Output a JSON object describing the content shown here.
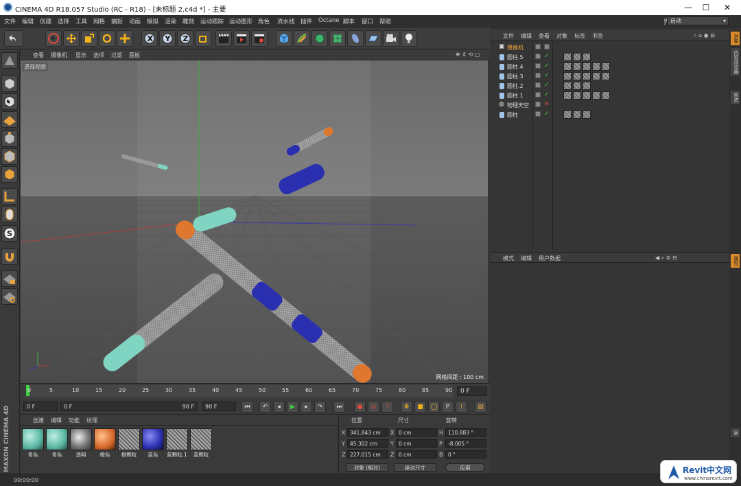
{
  "window": {
    "title": "CINEMA 4D R18.057 Studio (RC - R18) - [未标题 2.c4d *] - 主要",
    "min": "—",
    "max": "☐",
    "close": "✕"
  },
  "menu": [
    "文件",
    "编辑",
    "创建",
    "选择",
    "工具",
    "网格",
    "捕捉",
    "动画",
    "模拟",
    "渲染",
    "雕刻",
    "运动跟踪",
    "运动图形",
    "角色",
    "流水线",
    "插件",
    "Octane",
    "脚本",
    "窗口",
    "帮助"
  ],
  "layout": {
    "label": "界面:",
    "value": "启动"
  },
  "viewport": {
    "menu": [
      "查看",
      "摄像机",
      "显示",
      "选项",
      "过滤",
      "面板"
    ],
    "label": "透视视图",
    "grid_info": "网格间距 : 100 cm"
  },
  "timeline": {
    "ticks": [
      "0",
      "5",
      "10",
      "15",
      "20",
      "25",
      "30",
      "35",
      "40",
      "45",
      "50",
      "55",
      "60",
      "65",
      "70",
      "75",
      "80",
      "85",
      "90"
    ],
    "frame": "0 F"
  },
  "transport": {
    "start": "0 F",
    "current": "0 F",
    "end_slider": "90 F",
    "end": "90 F"
  },
  "materials": {
    "menu": [
      "创建",
      "编辑",
      "功能",
      "纹理"
    ],
    "items": [
      "青色",
      "青色",
      "透明",
      "橙色",
      "橙颗粒",
      "蓝色",
      "蓝颗粒.1",
      "蓝颗粒"
    ]
  },
  "coords": {
    "headers": [
      "位置",
      "尺寸",
      "旋转"
    ],
    "rows": [
      {
        "a": "X",
        "pos": "341.843 cm",
        "b": "X",
        "size": "0 cm",
        "c": "H",
        "rot": "110.883 °"
      },
      {
        "a": "Y",
        "pos": "45.302 cm",
        "b": "Y",
        "size": "0 cm",
        "c": "P",
        "rot": "-8.005 °"
      },
      {
        "a": "Z",
        "pos": "227.015 cm",
        "b": "Z",
        "size": "0 cm",
        "c": "B",
        "rot": "0 °"
      }
    ],
    "mode": "对象 (相对)",
    "size_mode": "绝对尺寸",
    "apply": "应用"
  },
  "objects": {
    "menu": [
      "文件",
      "编辑",
      "查看",
      "对象",
      "标签",
      "书签"
    ],
    "items": [
      {
        "name": "摄像机",
        "color": "#e8a33c",
        "tags": 0
      },
      {
        "name": "圆柱.5",
        "color": "#dddddd",
        "tags": 3
      },
      {
        "name": "圆柱.4",
        "color": "#dddddd",
        "tags": 5
      },
      {
        "name": "圆柱.3",
        "color": "#dddddd",
        "tags": 5
      },
      {
        "name": "圆柱.2",
        "color": "#dddddd",
        "tags": 3
      },
      {
        "name": "圆柱.1",
        "color": "#dddddd",
        "tags": 5
      },
      {
        "name": "物理天空",
        "color": "#dddddd",
        "tags": 0
      },
      {
        "name": "圆柱",
        "color": "#dddddd",
        "tags": 3
      }
    ]
  },
  "attributes": {
    "menu": [
      "模式",
      "编辑",
      "用户数据"
    ]
  },
  "right_tabs": [
    "对象",
    "内容浏览器",
    "构造",
    "属性",
    "层"
  ],
  "status": "00:00:00",
  "brand": "MAXON CINEMA 4D",
  "watermark": {
    "title": "Revit中文网",
    "url": "www.chinarevit.com"
  },
  "colors": {
    "orange": "#e0772e",
    "blue": "#2a2fb0",
    "cyan": "#7fd4c2",
    "accent": "#e8a33c"
  }
}
